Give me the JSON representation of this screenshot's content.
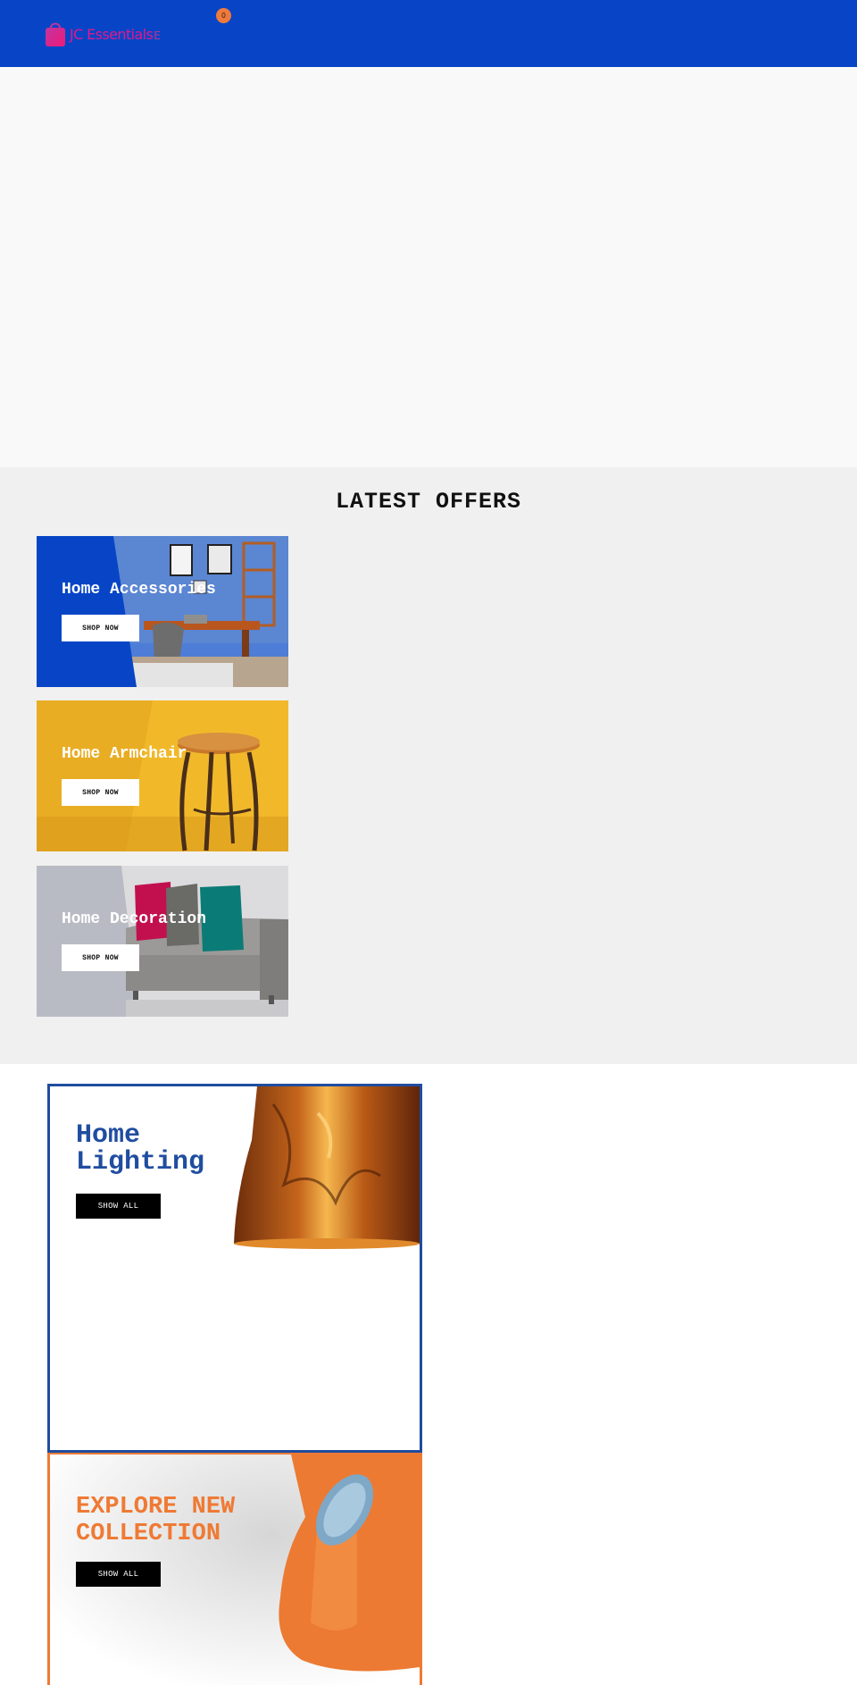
{
  "colors": {
    "header_bg": "#0745c6",
    "brand_pink": "#e0198c",
    "badge_orange": "#f07a3c",
    "lighting_blue": "#1f4d9f",
    "explore_orange": "#ef7a34"
  },
  "header": {
    "logo_icon": "shopping-bag-icon",
    "logo_text": "JC Essentials",
    "logo_tail": "E",
    "cart_count": "0"
  },
  "latest_offers": {
    "title": "LATEST OFFERS",
    "items": [
      {
        "title": "Home Accessories",
        "button": "SHOP NOW"
      },
      {
        "title": "Home Armchair",
        "button": "SHOP NOW"
      },
      {
        "title": "Home Decoration",
        "button": "SHOP NOW"
      }
    ]
  },
  "collections": [
    {
      "title_line1": "Home",
      "title_line2": "Lighting",
      "button": "SHOW ALL"
    },
    {
      "title_line1": "EXPLORE NEW",
      "title_line2": "COLLECTION",
      "button": "SHOW ALL"
    }
  ]
}
